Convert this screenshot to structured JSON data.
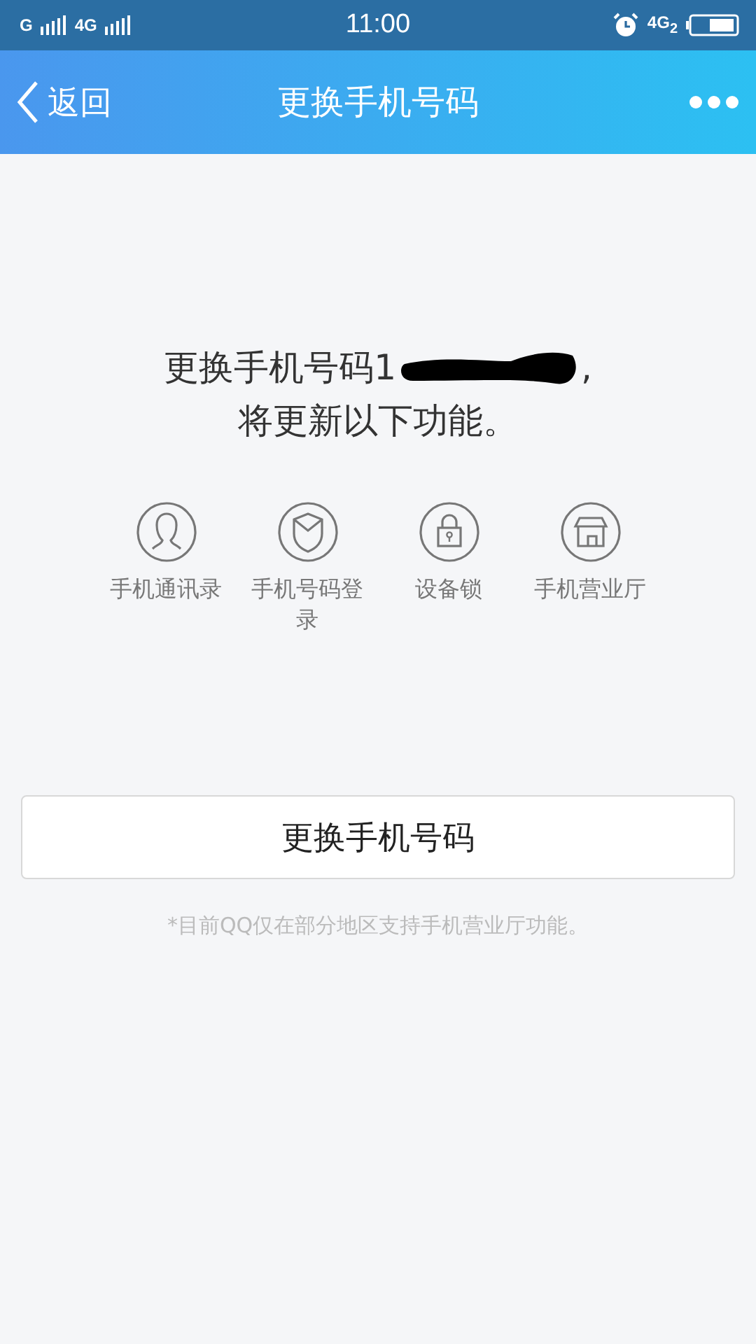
{
  "status_bar": {
    "carrier_1": "G",
    "carrier_2": "4G",
    "time": "11:00",
    "network": "4G",
    "network_sub": "2"
  },
  "nav_bar": {
    "back": "返回",
    "title": "更换手机号码"
  },
  "intro": {
    "line_1": "更换手机号码1",
    "redacted": true,
    "line_1_end": ",",
    "line_2": "将更新以下功能。"
  },
  "features": [
    {
      "kind": "contacts",
      "label": "手机通讯录"
    },
    {
      "kind": "shield",
      "label": "手机号码登录"
    },
    {
      "kind": "lock",
      "label": "设备锁"
    },
    {
      "kind": "store",
      "label": "手机营业厅"
    }
  ],
  "action_button": "更换手机号码",
  "note": "*目前QQ仅在部分地区支持手机营业厅功能。"
}
